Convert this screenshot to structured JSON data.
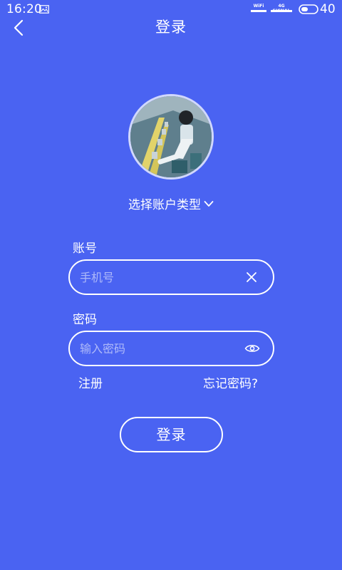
{
  "status_bar": {
    "time": "16:20",
    "wifi_label": "WiFi",
    "signal_label": "4G SIGNAL",
    "battery": "40"
  },
  "header": {
    "title": "登录",
    "back_icon": "chevron-left-icon"
  },
  "account_type": {
    "label": "选择账户类型",
    "icon": "chevron-down-icon"
  },
  "form": {
    "account_label": "账号",
    "phone_placeholder": "手机号",
    "phone_value": "",
    "password_label": "密码",
    "password_placeholder": "输入密码",
    "password_value": ""
  },
  "links": {
    "register": "注册",
    "forgot_password": "忘记密码?"
  },
  "login_button": "登录",
  "colors": {
    "background": "#4a63f2",
    "foreground": "#ffffff"
  }
}
